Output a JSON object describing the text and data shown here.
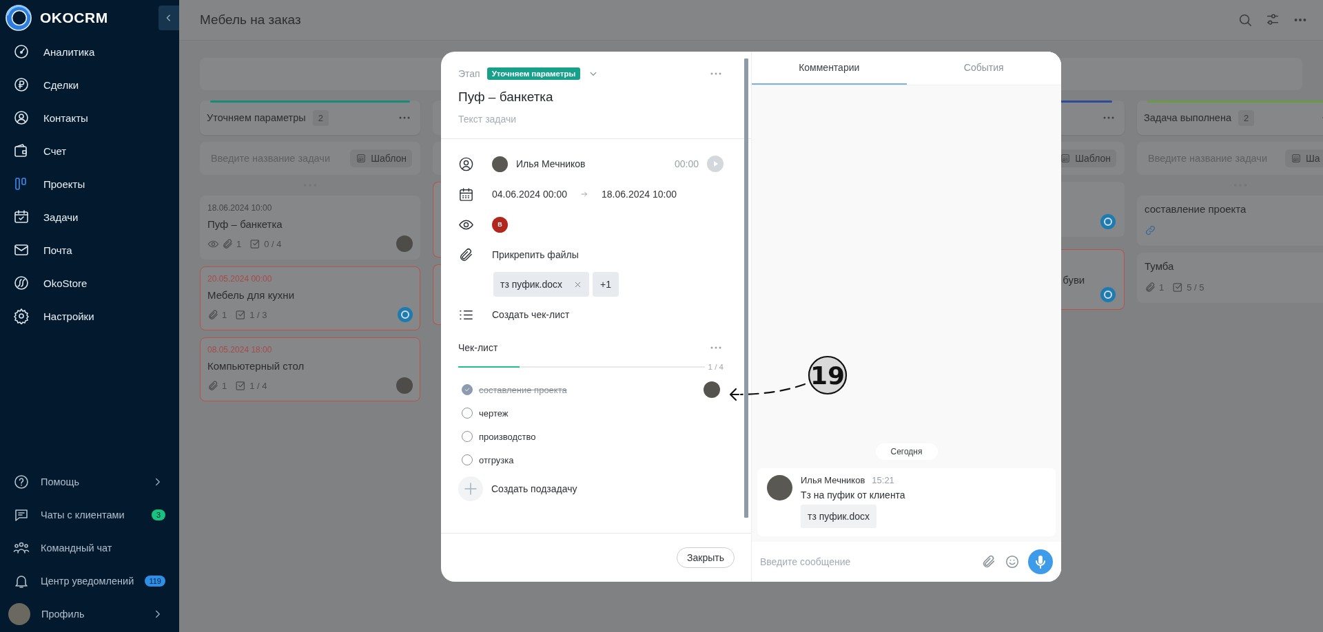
{
  "sidebar": {
    "brand": "OKOCRM",
    "items": [
      {
        "label": "Аналитика",
        "selected": false
      },
      {
        "label": "Сделки",
        "selected": false
      },
      {
        "label": "Контакты",
        "selected": false
      },
      {
        "label": "Счет",
        "selected": false
      },
      {
        "label": "Проекты",
        "selected": true
      },
      {
        "label": "Задачи",
        "selected": false
      },
      {
        "label": "Почта",
        "selected": false
      },
      {
        "label": "OkoStore",
        "selected": false
      },
      {
        "label": "Настройки",
        "selected": false
      }
    ],
    "bottom_items": [
      {
        "label": "Помощь",
        "expandable": true
      },
      {
        "label": "Чаты с клиентами",
        "expandable": false,
        "badge": "3",
        "color": "#19c37d"
      },
      {
        "label": "Командный чат",
        "expandable": false
      },
      {
        "label": "Центр уведомлений",
        "expandable": false,
        "badge": "119",
        "color": "#2f8fe6"
      }
    ],
    "profile": {
      "label": "Профиль",
      "expandable": true
    }
  },
  "page": {
    "title": "Мебель на заказ"
  },
  "board": {
    "columns": [
      {
        "kind": "full",
        "title": "Уточняем параметры",
        "count": "2",
        "color": "#178a78",
        "placeholder": "Введите название задачи",
        "template": "Шаблон",
        "cards": [
          {
            "date": "18.06.2024 10:00",
            "title": "Пуф – банкетка",
            "overdue": false,
            "watched": true,
            "attachments": "1",
            "checklist": "0 / 4",
            "avatar": true,
            "chat": false
          },
          {
            "date": "20.05.2024 00:00",
            "title": "Мебель для кухни",
            "overdue": true,
            "watched": false,
            "attachments": "1",
            "checklist": "1 / 3",
            "avatar": false,
            "chat": true
          },
          {
            "date": "08.05.2024 18:00",
            "title": "Компьютерный стол",
            "overdue": true,
            "watched": false,
            "attachments": "1",
            "checklist": "1 / 4",
            "avatar": true,
            "chat": false
          }
        ]
      },
      {
        "kind": "edge",
        "cards": [
          {
            "overdue": true
          },
          {
            "overdue": true
          }
        ]
      },
      {
        "kind": "slice",
        "color": "#2c4a9a",
        "template": "Шаблон",
        "cards": [
          {
            "overdue": false,
            "chat": true
          },
          {
            "overdue": true,
            "title": "буви",
            "chat": true
          }
        ]
      },
      {
        "kind": "full",
        "title": "Задача выполнена",
        "count": "2",
        "color": "#6a9a45",
        "placeholder": "Введите название задачи",
        "template": "Ша",
        "cards": [
          {
            "title": "составление проекта",
            "linked": true,
            "overdue": false
          },
          {
            "title": "Тумба",
            "attachments": "1",
            "checklist": "5 / 5",
            "overdue": false
          }
        ]
      }
    ]
  },
  "task": {
    "stage_label": "Этап",
    "stage": "Уточняем параметры",
    "title": "Пуф – банкетка",
    "description_placeholder": "Текст задачи",
    "assignee": {
      "name": "Илья Мечников",
      "timer": "00:00"
    },
    "start": "04.06.2024 00:00",
    "end": "18.06.2024 10:00",
    "watchers": [
      {
        "initial": "В"
      }
    ],
    "attach_label": "Прикрепить файлы",
    "files": [
      {
        "name": "тз пуфик.docx"
      }
    ],
    "more_files": "+1",
    "create_checklist": "Создать чек-лист",
    "checklist": {
      "title": "Чек-лист",
      "level": 0.25,
      "progress": "1 / 4",
      "items": [
        {
          "text": "составление проекта",
          "checked": true,
          "assigned": true
        },
        {
          "text": "чертеж",
          "checked": false,
          "assigned": false
        },
        {
          "text": "производство",
          "checked": false,
          "assigned": false
        },
        {
          "text": "отгрузка",
          "checked": false,
          "assigned": false
        }
      ]
    },
    "create_subtask": "Создать подзадачу",
    "close": "Закрыть"
  },
  "comments": {
    "tabs": [
      {
        "label": "Комментарии",
        "selected": true
      },
      {
        "label": "События",
        "selected": false
      }
    ],
    "day": "Сегодня",
    "messages": [
      {
        "author": "Илья Мечников",
        "time": "15:21",
        "text": "Тз на пуфик от клиента",
        "attachment": "тз пуфик.docx"
      }
    ],
    "input_placeholder": "Введите сообщение"
  },
  "annotation": {
    "number": "19"
  }
}
